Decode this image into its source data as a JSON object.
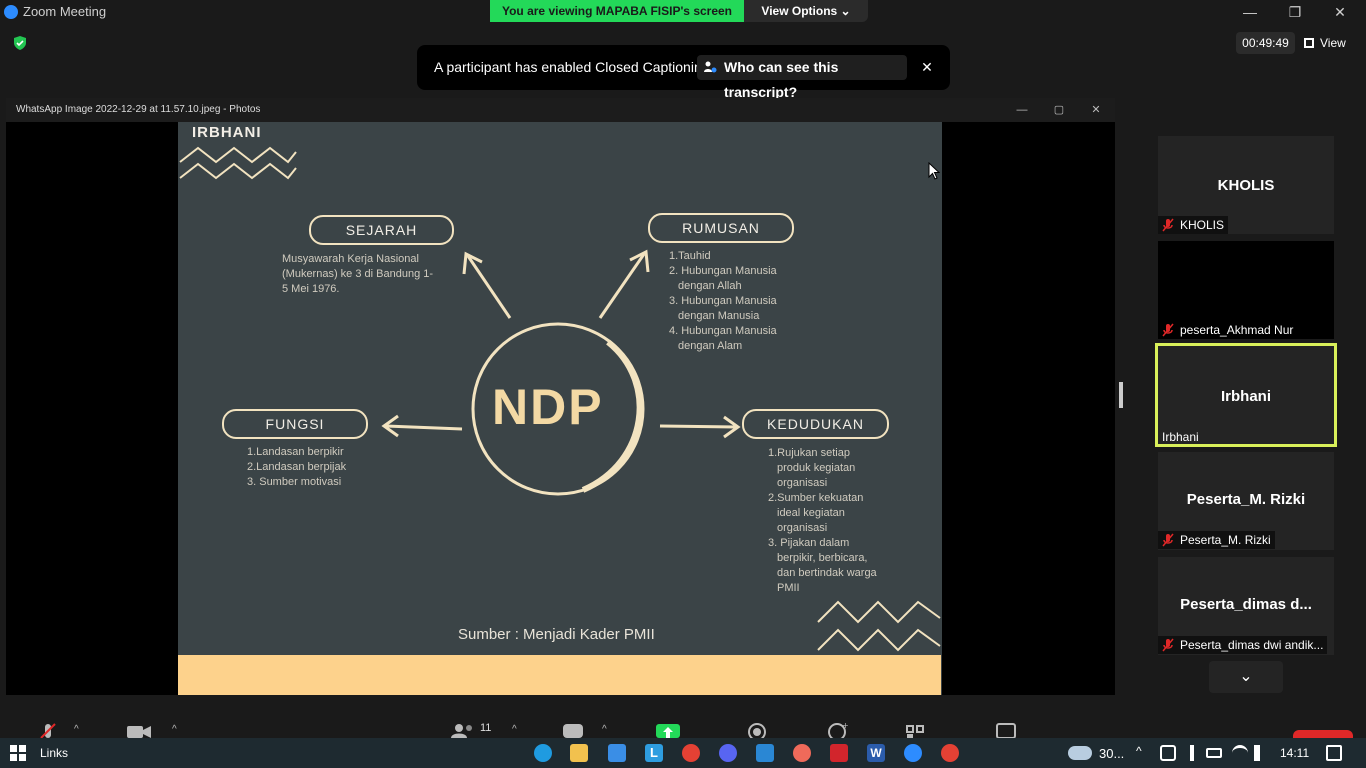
{
  "window": {
    "title": "Zoom Meeting",
    "minimize": "—",
    "maximize": "❐",
    "close": "✕"
  },
  "share_banner": "You are viewing MAPABA FISIP's screen",
  "view_options": "View Options ⌄",
  "timer": "00:49:49",
  "view_button": "View",
  "caption_notice": {
    "text": "A participant has enabled Closed Captioning",
    "link": "Who can see this transcript?",
    "close": "✕"
  },
  "shared_window": {
    "title": "WhatsApp Image 2022-12-29 at 11.57.10.jpeg - Photos",
    "min": "—",
    "max": "▢",
    "close": "✕"
  },
  "slide": {
    "corner_label": "IRBHANI",
    "center": "NDP",
    "sejarah": {
      "title": "SEJARAH",
      "lines": [
        "Musyawarah    Kerja    Nasional",
        "(Mukernas) ke 3 di Bandung 1-",
        "5 Mei 1976."
      ]
    },
    "rumusan": {
      "title": "RUMUSAN",
      "lines": [
        "1.Tauhid",
        "2. Hubungan Manusia",
        "dengan Allah",
        "3. Hubungan Manusia",
        "dengan Manusia",
        "4. Hubungan Manusia",
        "dengan Alam"
      ]
    },
    "fungsi": {
      "title": "FUNGSI",
      "lines": [
        "1.Landasan berpikir",
        "2.Landasan berpijak",
        "3. Sumber motivasi"
      ]
    },
    "kedudukan": {
      "title": "KEDUDUKAN",
      "lines": [
        "1.Rujukan setiap",
        "produk kegiatan",
        "organisasi",
        "2.Sumber kekuatan",
        "ideal kegiatan",
        "organisasi",
        "3. Pijakan dalam",
        "berpikir, berbicara,",
        "dan bertindak warga",
        "PMII"
      ]
    },
    "source": "Sumber : Menjadi Kader PMII"
  },
  "participants": [
    {
      "center": "KHOLIS",
      "label": "KHOLIS",
      "muted": true
    },
    {
      "center": "",
      "label": "peserta_Akhmad Nur",
      "muted": true
    },
    {
      "center": "Irbhani",
      "label": "Irbhani",
      "muted": false,
      "active": true
    },
    {
      "center": "Peserta_M. Rizki",
      "label": "Peserta_M. Rizki",
      "muted": true
    },
    {
      "center": "Peserta_dimas   d...",
      "label": "Peserta_dimas dwi andik...",
      "muted": true
    }
  ],
  "toolbar": {
    "participants_count": "11"
  },
  "taskbar": {
    "links": "Links",
    "weather": "30...",
    "clock": "14:11"
  },
  "colors": {
    "share_green": "#23d959",
    "active_speaker": "#d9f05a",
    "slide_bg": "#3b4447",
    "slide_accent": "#fdd28c"
  }
}
